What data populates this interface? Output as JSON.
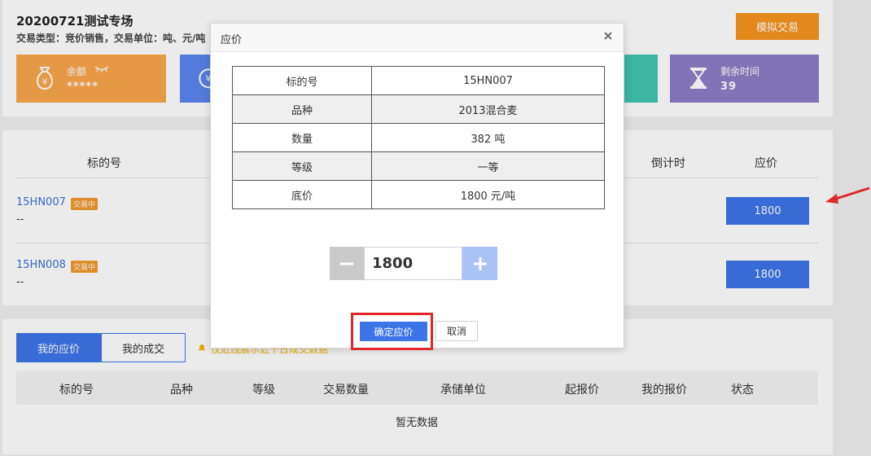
{
  "header": {
    "title": "20200721测试专场",
    "subtitle": "交易类型：竞价销售，交易单位：吨、元/吨",
    "simulate_button": "模拟交易"
  },
  "cards": {
    "balance": {
      "label": "余额",
      "value": "*****"
    },
    "time": {
      "label": "剩余时间",
      "value": "39"
    }
  },
  "list": {
    "columns": {
      "lot": "标的号",
      "countdown": "倒计时",
      "bid": "应价"
    },
    "rows": [
      {
        "lot": "15HN007",
        "badge": "交易中",
        "dash": "--",
        "bid_value": "1800"
      },
      {
        "lot": "15HN008",
        "badge": "交易中",
        "dash": "--",
        "bid_value": "1800"
      }
    ]
  },
  "bottom": {
    "tabs": {
      "my_bids": "我的应价",
      "my_deals": "我的成交"
    },
    "notice": "仅近线展示近十日成交数据",
    "columns": [
      "标的号",
      "品种",
      "等级",
      "交易数量",
      "承储单位",
      "起报价",
      "我的报价",
      "状态"
    ],
    "empty": "暂无数据"
  },
  "modal": {
    "title": "应价",
    "rows": [
      {
        "key": "标的号",
        "value": "15HN007"
      },
      {
        "key": "品种",
        "value": "2013混合麦"
      },
      {
        "key": "数量",
        "value": "382 吨"
      },
      {
        "key": "等级",
        "value": "一等"
      },
      {
        "key": "底价",
        "value": "1800 元/吨"
      }
    ],
    "price_value": "1800",
    "confirm_button": "确定应价",
    "cancel_button": "取消"
  },
  "colors": {
    "primary": "#3d75e8",
    "orange": "#f7941d",
    "highlight_border": "#e0262a"
  }
}
